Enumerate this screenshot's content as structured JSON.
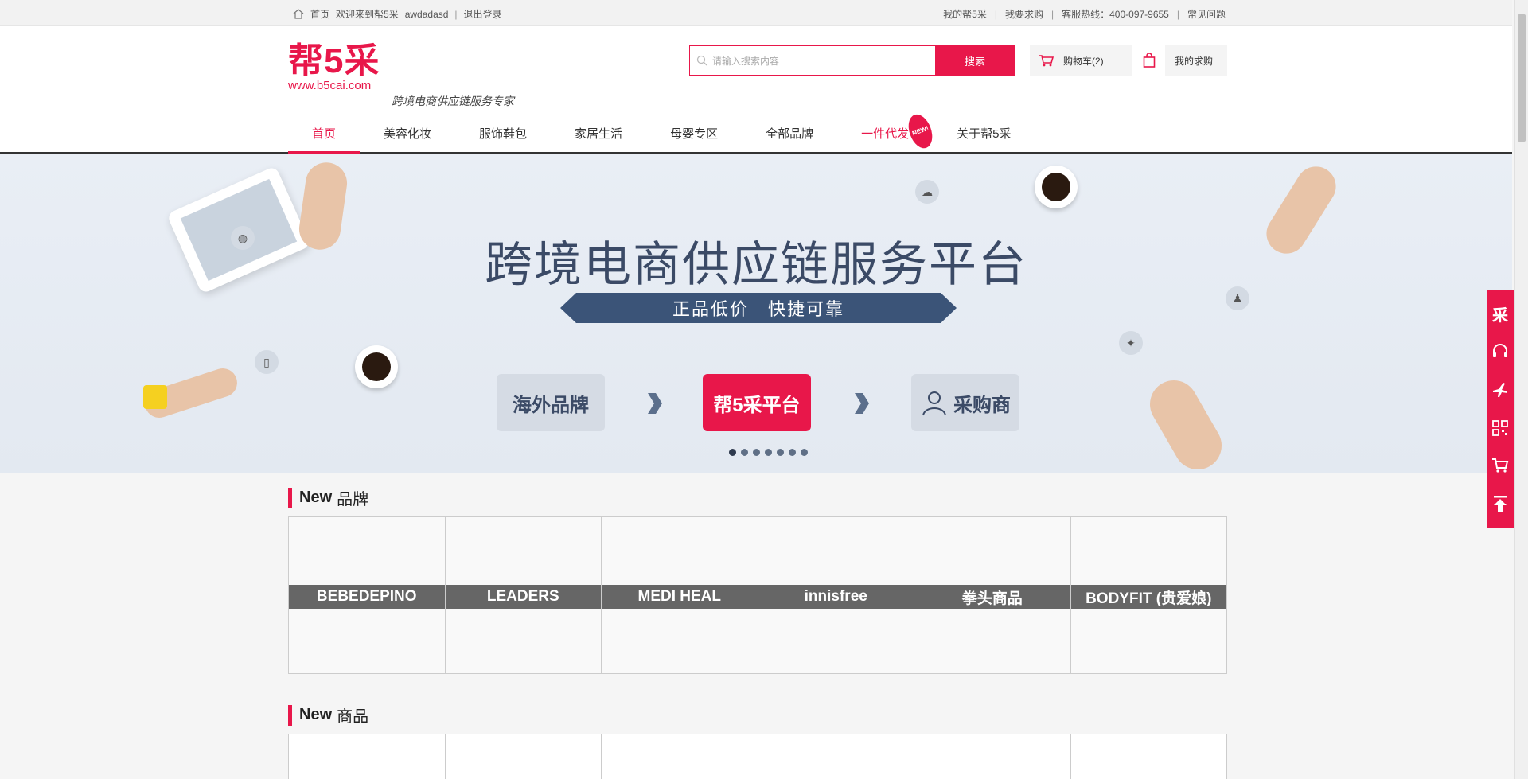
{
  "topbar": {
    "home": "首页",
    "welcome": "欢迎来到帮5采",
    "username": "awdadasd",
    "logout": "退出登录",
    "my_account": "我的帮5采",
    "want_buy": "我要求购",
    "hotline": "客服热线：400-097-9655",
    "faq": "常见问题"
  },
  "header": {
    "logo_text": "帮5采",
    "logo_url": "www.b5cai.com",
    "slogan": "跨境电商供应链服务专家",
    "search_placeholder": "请输入搜索内容",
    "search_button": "搜索",
    "cart": "购物车(2)",
    "my_purchase": "我的求购"
  },
  "nav": {
    "items": [
      {
        "label": "首页"
      },
      {
        "label": "美容化妆"
      },
      {
        "label": "服饰鞋包"
      },
      {
        "label": "家居生活"
      },
      {
        "label": "母婴专区"
      },
      {
        "label": "全部品牌"
      },
      {
        "label": "一件代发"
      },
      {
        "label": "关于帮5采"
      }
    ],
    "new_badge": "NEW!"
  },
  "banner": {
    "headline": "跨境电商供应链服务平台",
    "ribbon": "正品低价　快捷可靠",
    "flow": [
      "海外品牌",
      "帮5采平台",
      "采购商"
    ],
    "slides": 7,
    "active_slide": 1
  },
  "brands_section": {
    "title_new": "New",
    "title": "品牌",
    "brands": [
      "BEBEDEPINO",
      "LEADERS",
      "MEDI HEAL",
      "innisfree",
      "拳头商品",
      "BODYFIT (贵爱娘)"
    ]
  },
  "products_section": {
    "title_new": "New",
    "title": "商品"
  },
  "sidebar": {
    "top_char": "采",
    "icons": [
      "logo-icon",
      "headset-icon",
      "plane-icon",
      "qrcode-icon",
      "cart-icon",
      "back-to-top-icon"
    ]
  },
  "colors": {
    "brand": "#e8174a",
    "navy": "#3b4a66"
  }
}
